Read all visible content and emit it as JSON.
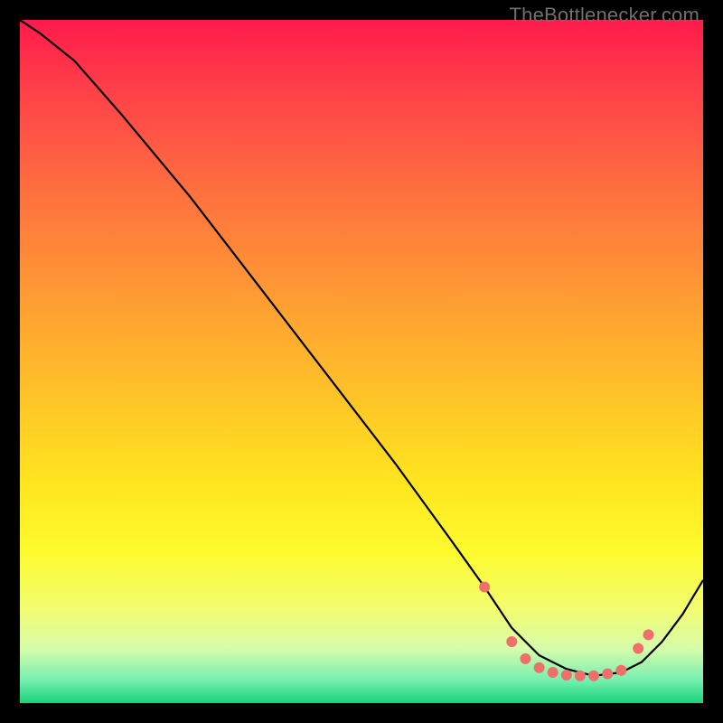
{
  "watermark": "TheBottlenecker.com",
  "chart_data": {
    "type": "line",
    "title": "",
    "xlabel": "",
    "ylabel": "",
    "xlim": [
      0,
      100
    ],
    "ylim": [
      0,
      100
    ],
    "grid": false,
    "background": {
      "stops": [
        {
          "offset": 0.0,
          "color": "#ff1a4b"
        },
        {
          "offset": 0.1,
          "color": "#ff3f49"
        },
        {
          "offset": 0.25,
          "color": "#ff6f3f"
        },
        {
          "offset": 0.4,
          "color": "#ff9a34"
        },
        {
          "offset": 0.55,
          "color": "#ffc328"
        },
        {
          "offset": 0.68,
          "color": "#ffe61f"
        },
        {
          "offset": 0.78,
          "color": "#fdfb2e"
        },
        {
          "offset": 0.86,
          "color": "#f3fd6e"
        },
        {
          "offset": 0.92,
          "color": "#d7fcaa"
        },
        {
          "offset": 0.965,
          "color": "#7af0b0"
        },
        {
          "offset": 1.0,
          "color": "#16d47a"
        }
      ]
    },
    "series": [
      {
        "name": "curve",
        "color": "#000000",
        "x": [
          0,
          3,
          8,
          15,
          25,
          35,
          45,
          55,
          63,
          68,
          72,
          76,
          80,
          84,
          88,
          91,
          94,
          97,
          100
        ],
        "y": [
          100,
          98,
          94,
          86,
          74,
          61,
          48,
          35,
          24,
          17,
          11,
          7,
          5,
          4,
          4.5,
          6,
          9,
          13,
          18
        ]
      }
    ],
    "markers": {
      "name": "dots",
      "color": "#ef6f6b",
      "radius_px": 6,
      "points": [
        {
          "x": 68,
          "y": 17
        },
        {
          "x": 72,
          "y": 9
        },
        {
          "x": 74,
          "y": 6.5
        },
        {
          "x": 76,
          "y": 5.2
        },
        {
          "x": 78,
          "y": 4.5
        },
        {
          "x": 80,
          "y": 4.1
        },
        {
          "x": 82,
          "y": 4.0
        },
        {
          "x": 84,
          "y": 4.0
        },
        {
          "x": 86,
          "y": 4.3
        },
        {
          "x": 88,
          "y": 4.8
        },
        {
          "x": 90.5,
          "y": 8
        },
        {
          "x": 92,
          "y": 10
        }
      ]
    }
  }
}
